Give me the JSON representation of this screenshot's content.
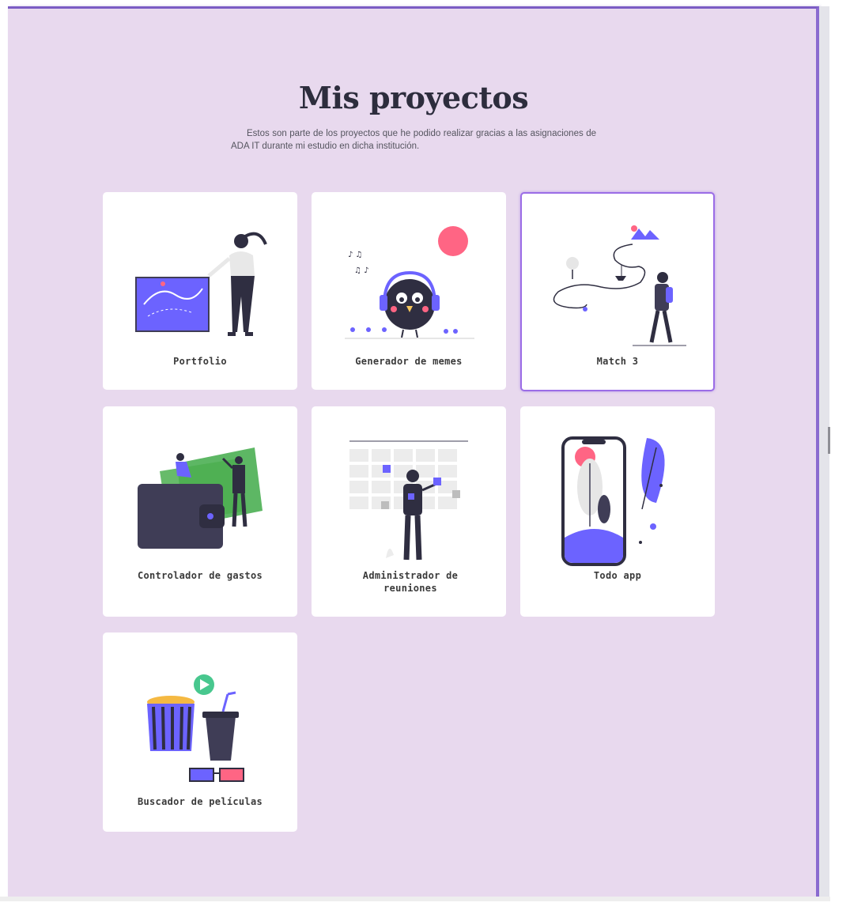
{
  "projects_section": {
    "title": "Mis proyectos",
    "description": "Estos son parte de los proyectos que he podido realizar gracias a las asignaciones de ADA IT durante mi estudio en dicha institución."
  },
  "projects": [
    {
      "label": "Portfolio",
      "illustration": "woman-with-canvas"
    },
    {
      "label": "Generador de memes",
      "illustration": "bird-with-headphones"
    },
    {
      "label": "Match 3",
      "illustration": "woman-with-map-path"
    },
    {
      "label": "Controlador de gastos",
      "illustration": "wallet-with-money"
    },
    {
      "label": "Administrador de reuniones",
      "illustration": "woman-with-calendar"
    },
    {
      "label": "Todo app",
      "illustration": "phone-with-leaf"
    },
    {
      "label": "Buscador de películas",
      "illustration": "popcorn-and-drink"
    }
  ],
  "active_project": "Match 3",
  "colors": {
    "background": "#e8d9ee",
    "accent": "#6c63ff",
    "highlight": "#ff6584",
    "card": "#ffffff"
  }
}
